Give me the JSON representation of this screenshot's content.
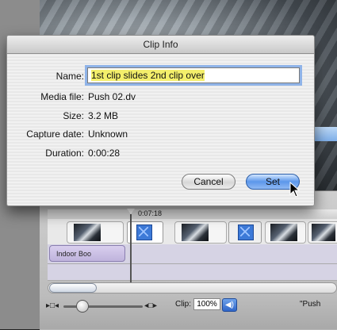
{
  "dialog": {
    "title": "Clip Info",
    "name_label": "Name:",
    "name_value": "1st clip slides 2nd clip over",
    "media_file_label": "Media file:",
    "media_file_value": "Push 02.dv",
    "size_label": "Size:",
    "size_value": "3.2 MB",
    "capture_date_label": "Capture date:",
    "capture_date_value": "Unknown",
    "duration_label": "Duration:",
    "duration_value": "0:00:28",
    "cancel_label": "Cancel",
    "set_label": "Set"
  },
  "timeline": {
    "playhead_time": "0:07:18",
    "audio_clip_label": "Indoor Boo"
  },
  "bottom_bar": {
    "clip_volume_label": "Clip:",
    "clip_volume_value": "100%",
    "project_name": "\"Push"
  },
  "icons": {
    "zoom_small": "zoom-out-icon",
    "zoom_large": "zoom-in-icon",
    "speaker": "speaker-icon",
    "cursor": "arrow-cursor-icon",
    "transition": "transition-icon"
  },
  "colors": {
    "accent_blue": "#5c97ea",
    "name_highlight": "#f4ef6b",
    "focus_ring": "#8fb3e8"
  }
}
